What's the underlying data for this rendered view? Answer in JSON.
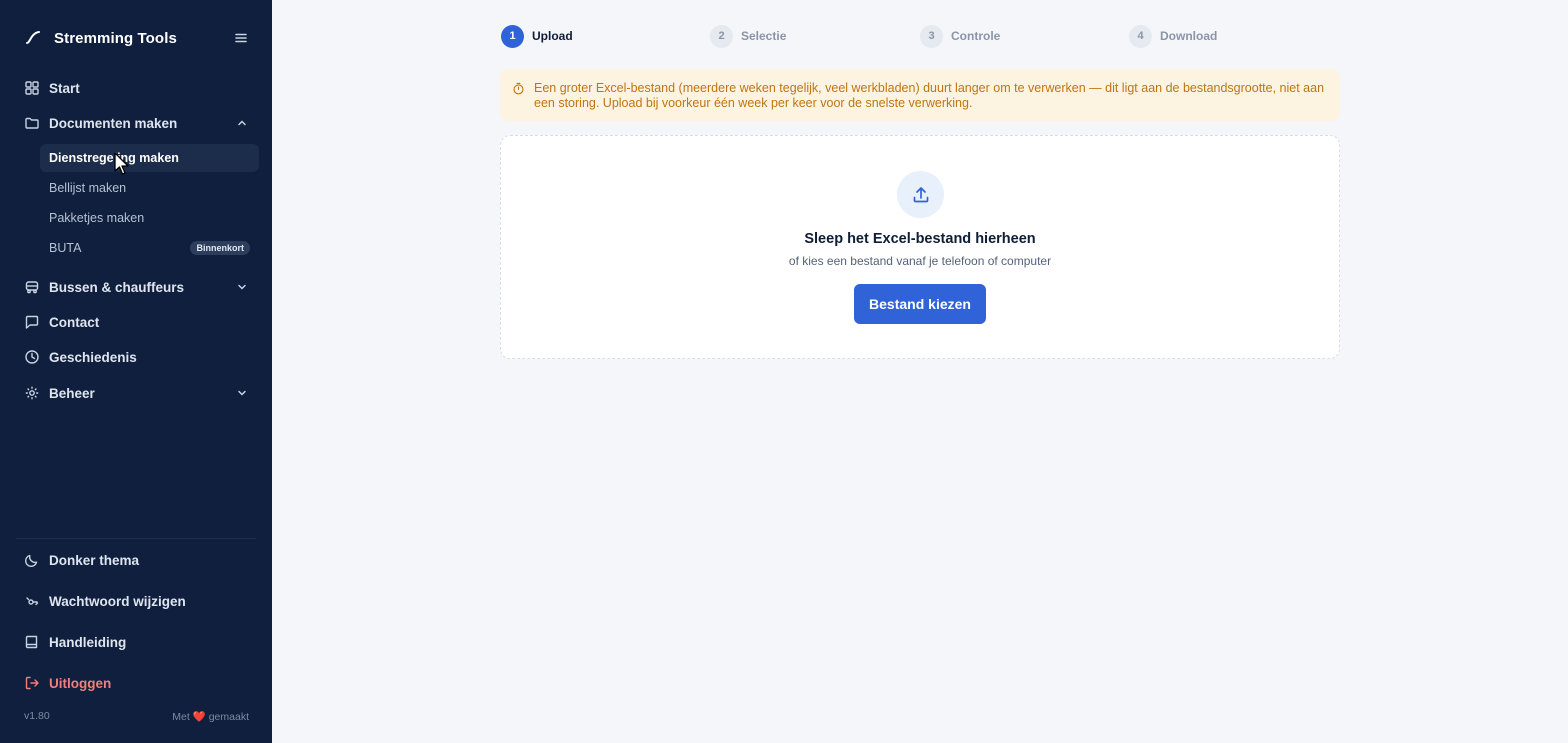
{
  "app": {
    "title": "Stremming Tools"
  },
  "sidebar": {
    "items": [
      {
        "label": "Start",
        "icon": "grid-icon"
      },
      {
        "label": "Documenten maken",
        "icon": "folder-icon",
        "expanded": true,
        "children": [
          {
            "label": "Dienstregeling maken",
            "active": true
          },
          {
            "label": "Bellijst maken"
          },
          {
            "label": "Pakketjes maken"
          },
          {
            "label": "BUTA",
            "badge": "Binnenkort"
          }
        ]
      },
      {
        "label": "Bussen & chauffeurs",
        "icon": "bus-icon",
        "expanded": false
      },
      {
        "label": "Contact",
        "icon": "chat-icon"
      },
      {
        "label": "Geschiedenis",
        "icon": "clock-icon"
      },
      {
        "label": "Beheer",
        "icon": "gear-icon",
        "expanded": false
      }
    ],
    "bottom": [
      {
        "label": "Donker thema",
        "icon": "moon-icon"
      },
      {
        "label": "Wachtwoord wijzigen",
        "icon": "key-icon"
      },
      {
        "label": "Handleiding",
        "icon": "book-icon"
      },
      {
        "label": "Uitloggen",
        "icon": "logout-icon",
        "color": "#f27f7f"
      }
    ],
    "footer": {
      "version": "v1.80",
      "made_prefix": "Met",
      "heart": "❤️",
      "made_suffix": "gemaakt"
    }
  },
  "stepper": {
    "steps": [
      {
        "num": "1",
        "label": "Upload",
        "active": true
      },
      {
        "num": "2",
        "label": "Selectie"
      },
      {
        "num": "3",
        "label": "Controle"
      },
      {
        "num": "4",
        "label": "Download"
      }
    ]
  },
  "notice": {
    "text": "Een groter Excel-bestand (meerdere weken tegelijk, veel werkbladen) duurt langer om te verwerken — dit ligt aan de bestandsgrootte, niet aan een storing. Upload bij voorkeur één week per keer voor de snelste verwerking."
  },
  "upload": {
    "title": "Sleep het Excel-bestand hierheen",
    "subtitle": "of kies een bestand vanaf je telefoon of computer",
    "button": "Bestand kiezen"
  },
  "colors": {
    "sidebar_bg": "#0f1f3d",
    "accent": "#2f63d7",
    "notice_bg": "#fdf3e1",
    "notice_text": "#c07512",
    "logout": "#f27f7f"
  }
}
